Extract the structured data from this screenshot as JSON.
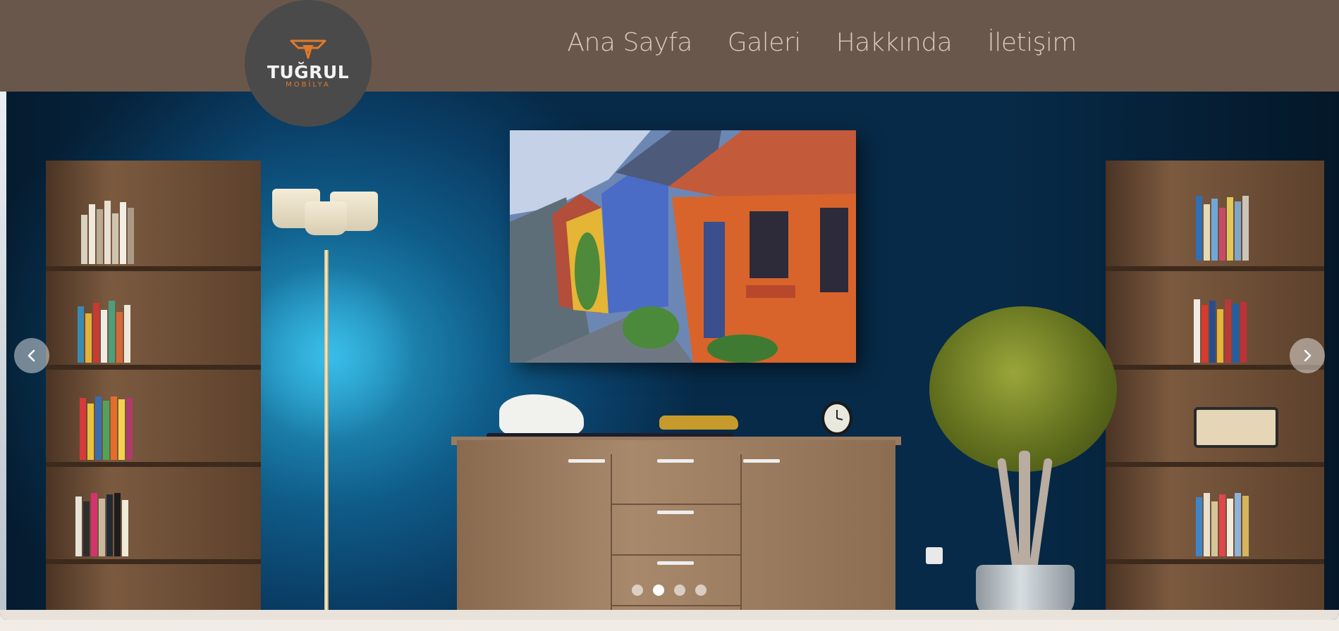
{
  "logo": {
    "name": "TUĞRUL",
    "sub": "MOBİLYA",
    "icon": "bull-horns-icon",
    "accent_color": "#e07a2c"
  },
  "header": {
    "background": "#6a574b"
  },
  "nav": {
    "items": [
      {
        "label": "Ana Sayfa"
      },
      {
        "label": "Galeri"
      },
      {
        "label": "Hakkında"
      },
      {
        "label": "İletişim"
      }
    ]
  },
  "slider": {
    "prev_icon": "chevron-left-icon",
    "next_icon": "chevron-right-icon",
    "slide_count": 4,
    "active_index": 1
  }
}
